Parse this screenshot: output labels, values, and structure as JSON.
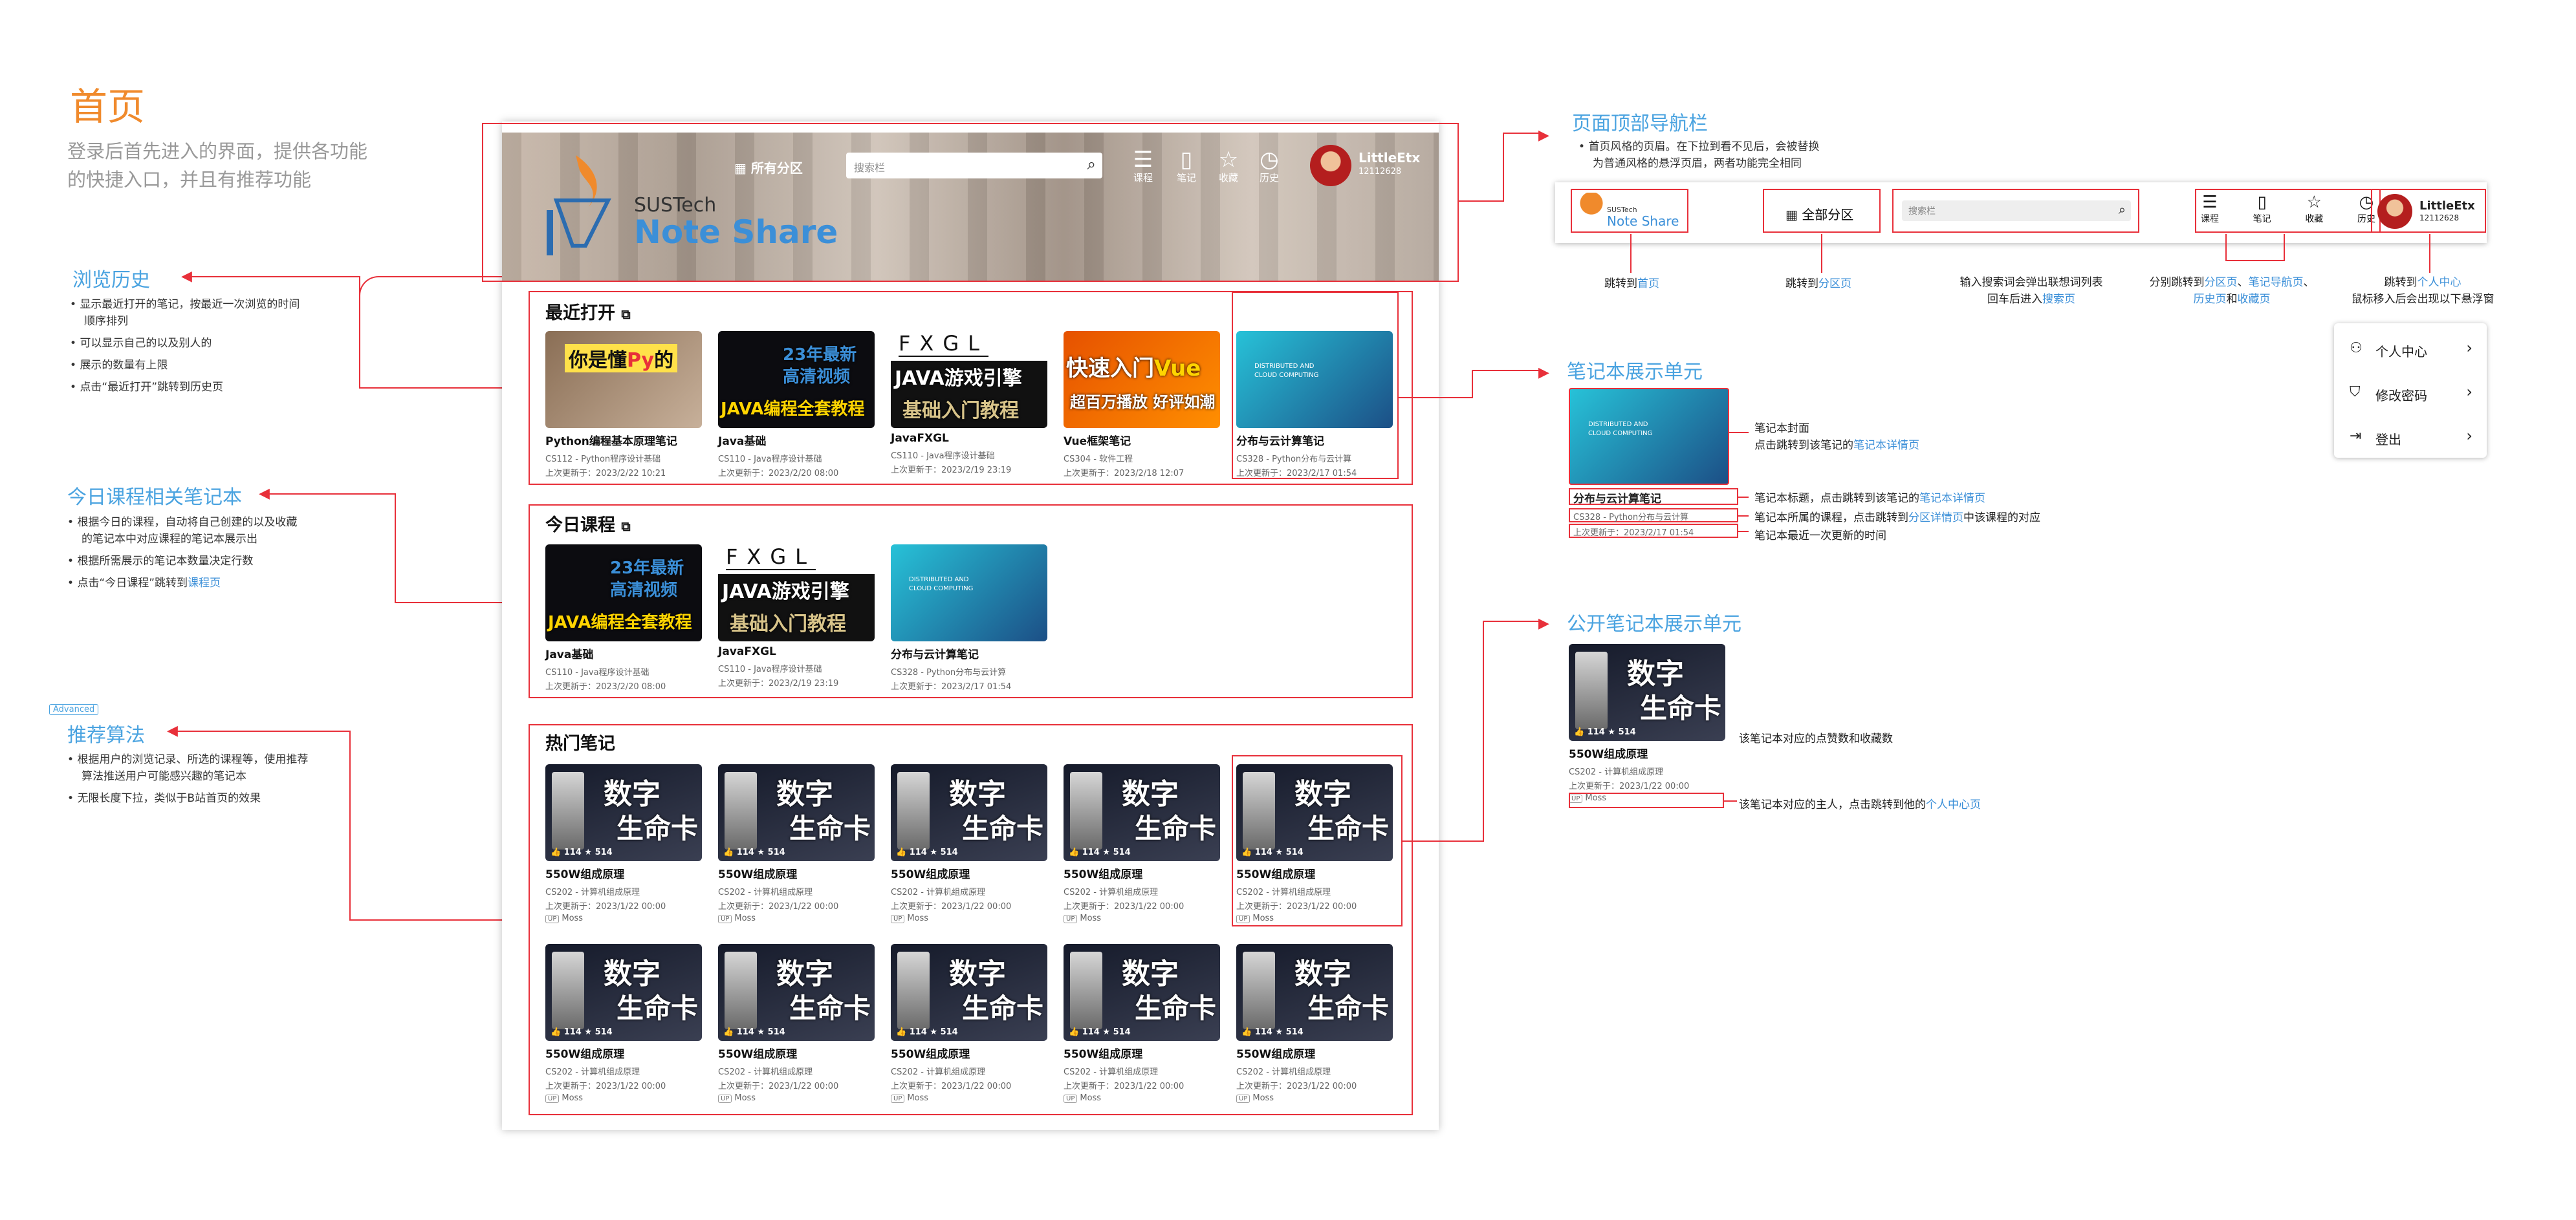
{
  "page": {
    "title": "首页",
    "desc1": "登录后首先进入的界面，提供各功能",
    "desc2": "的快捷入口，并且有推荐功能"
  },
  "browse": {
    "title": "浏览历史",
    "items": [
      "显示最近打开的笔记，按最近一次浏览的时间顺序排列",
      "可以显示自己的以及别人的",
      "展示的数量有上限",
      "点击“最近打开”跳转到历史页"
    ]
  },
  "today": {
    "title": "今日课程相关笔记本",
    "items": [
      "根据今日的课程，自动将自己创建的以及收藏的笔记本中对应课程的笔记本展示出",
      "根据所需展示的笔记本数量决定行数"
    ],
    "last_prefix": "点击“今日课程”跳转到",
    "last_link": "课程页"
  },
  "recommend": {
    "badge": "Advanced",
    "title": "推荐算法",
    "items": [
      "根据用户的浏览记录、所选的课程等，使用推荐算法推送用户可能感兴趣的笔记本",
      "无限长度下拉，类似于B站首页的效果"
    ]
  },
  "header": {
    "logo_top": "SUSTech",
    "logo_bottom": "Note Share",
    "all_sections": "所有分区",
    "search_placeholder": "搜索栏",
    "icons": [
      {
        "name": "course",
        "label": "课程"
      },
      {
        "name": "note",
        "label": "笔记"
      },
      {
        "name": "fav",
        "label": "收藏"
      },
      {
        "name": "history",
        "label": "历史"
      }
    ],
    "user_name": "LittleEtx",
    "user_id": "12112628"
  },
  "recent": {
    "title": "最近打开",
    "cards": [
      {
        "title": "Python编程基本原理笔记",
        "course": "CS112 - Python程序设计基础",
        "updated": "上次更新于：2023/2/22 10:21",
        "thumb": "你是懂Py的"
      },
      {
        "title": "Java基础",
        "course": "CS110 - Java程序设计基础",
        "updated": "上次更新于：2023/2/20 08:00",
        "thumb": "23年最新 高清视频 JAVA编程全套教程"
      },
      {
        "title": "JavaFXGL",
        "course": "CS110 - Java程序设计基础",
        "updated": "上次更新于：2023/2/19 23:19",
        "thumb": "FXGL JAVA游戏引擎 基础入门教程"
      },
      {
        "title": "Vue框架笔记",
        "course": "CS304 - 软件工程",
        "updated": "上次更新于：2023/2/18 12:07",
        "thumb": "快速入门Vue 超百万播放 好评如潮"
      },
      {
        "title": "分布与云计算笔记",
        "course": "CS328 - Python分布与云计算",
        "updated": "上次更新于：2023/2/17 01:54",
        "thumb": "DISTRIBUTED AND CLOUD COMPUTING"
      }
    ]
  },
  "todaysec": {
    "title": "今日课程",
    "cards": [
      {
        "title": "Java基础",
        "course": "CS110 - Java程序设计基础",
        "updated": "上次更新于：2023/2/20 08:00"
      },
      {
        "title": "JavaFXGL",
        "course": "CS110 - Java程序设计基础",
        "updated": "上次更新于：2023/2/19 23:19"
      },
      {
        "title": "分布与云计算笔记",
        "course": "CS328 - Python分布与云计算",
        "updated": "上次更新于：2023/2/17 01:54"
      }
    ]
  },
  "hot": {
    "title": "热门笔记",
    "card": {
      "title": "550W组成原理",
      "course": "CS202 - 计算机组成原理",
      "updated": "上次更新于：2023/1/22 00:00",
      "owner": "Moss",
      "likes": "114",
      "stars": "514",
      "thumb_line1": "数字",
      "thumb_line2": "生命卡"
    }
  },
  "nav_annot": {
    "title": "页面顶部导航栏",
    "desc1": "首页风格的页眉。在下拉到看不见后，会被替换",
    "desc2": "为普通风格的悬浮页眉，两者功能完全相同",
    "mini_all": "全部分区",
    "mini_search": "搜索栏",
    "jump_home_prefix": "跳转到",
    "jump_home_link": "首页",
    "jump_section_prefix": "跳转到",
    "jump_section_link": "分区页",
    "search_hint1": "输入搜索词会弹出联想词列表",
    "search_hint2_prefix": "回车后进入",
    "search_hint2_link": "搜索页",
    "icons_hint_prefix": "分别跳转到",
    "icons_link1": "分区页",
    "icons_sep1": "、",
    "icons_link2": "笔记导航页",
    "icons_sep2": "、",
    "icons_link3": "历史页",
    "icons_and": "和",
    "icons_link4": "收藏页",
    "user_hint_prefix": "跳转到",
    "user_hint_link": "个人中心",
    "user_hint2": "鼠标移入后会出现以下悬浮窗",
    "menu": [
      "个人中心",
      "修改密码",
      "登出"
    ]
  },
  "note_annot": {
    "title": "笔记本展示单元",
    "cover1": "笔记本封面",
    "cover2_prefix": "点击跳转到该笔记的",
    "cover2_link": "笔记本详情页",
    "title_hint_prefix": "笔记本标题，点击跳转到该笔记的",
    "title_hint_link": "笔记本详情页",
    "course_hint_prefix": "笔记本所属的课程，点击跳转到",
    "course_hint_link": "分区详情页",
    "course_hint_suffix": "中该课程的对应",
    "time_hint": "笔记本最近一次更新的时间",
    "card_title": "分布与云计算笔记",
    "card_course": "CS328 - Python分布与云计算",
    "card_updated": "上次更新于：2023/2/17 01:54"
  },
  "public_annot": {
    "title": "公开笔记本展示单元",
    "likes_hint": "该笔记本对应的点赞数和收藏数",
    "owner_hint_prefix": "该笔记本对应的主人，点击跳转到他的",
    "owner_hint_link": "个人中心页"
  }
}
